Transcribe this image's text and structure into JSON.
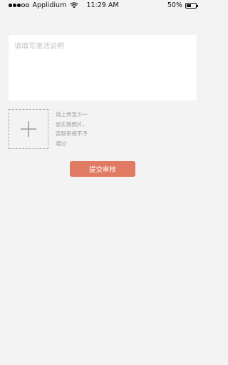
{
  "status_bar": {
    "carrier": "Applidium",
    "time": "11:29 AM",
    "battery": "50%",
    "battery_level": 0.5,
    "signal_bars_filled": 3,
    "signal_bars_total": 5
  },
  "form": {
    "description_placeholder": "请填写激活说明",
    "description_value": "",
    "upload_hint_lines": [
      "请上传至少一",
      "张实物照片，",
      "否则审核不予",
      "通过"
    ],
    "submit_label": "提交审核"
  },
  "colors": {
    "accent": "#e07a62",
    "background": "#f3f3f3"
  },
  "icons": {
    "upload": "plus-icon",
    "network": "wifi-icon"
  }
}
